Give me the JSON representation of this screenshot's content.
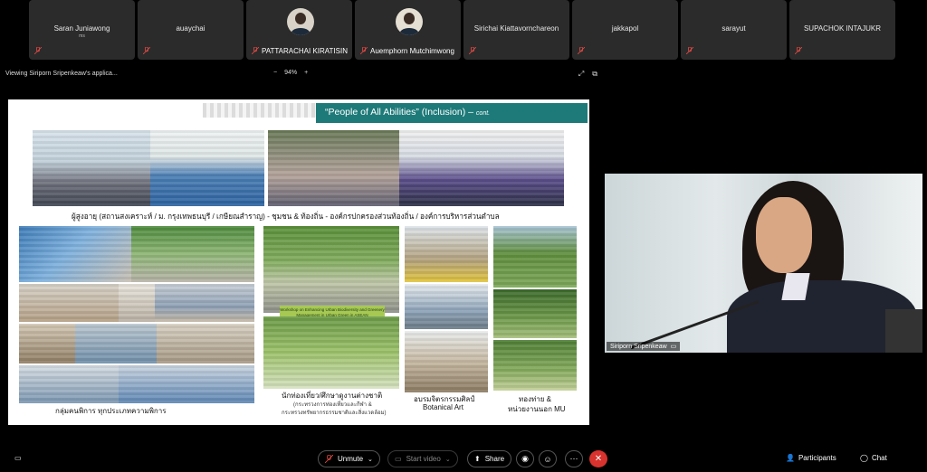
{
  "participants": [
    {
      "name": "Saran Juniawong",
      "sub": "ms"
    },
    {
      "name": "auaychai",
      "sub": ""
    },
    {
      "name": "PATTARACHAI KIRATISIN",
      "sub": "",
      "avatar": true
    },
    {
      "name": "Auemphorn Mutchimwong",
      "sub": "",
      "avatar": true
    },
    {
      "name": "Sirichai Kiattavornchareon",
      "sub": ""
    },
    {
      "name": "jakkapol",
      "sub": ""
    },
    {
      "name": "sarayut",
      "sub": ""
    },
    {
      "name": "SUPACHOK INTAJUKR",
      "sub": ""
    }
  ],
  "share": {
    "title": "Viewing Siriporn Sripenkeaw's applica...",
    "zoom_minus": "−",
    "zoom": "94%",
    "zoom_plus": "+"
  },
  "slide": {
    "banner": "“People of All Abilities” (Inclusion) –",
    "banner_cont": "cont.",
    "captions": {
      "row1": "ผู้สูงอายุ (สถานสงเคราะห์ / ม. กรุงเทพธนบุรี / เกษียณสำราญ) - ชุมชน & ท้องถิ่น - องค์กรปกครองส่วนท้องถิ่น / องค์การบริหารส่วนตำบล",
      "disabled": "กลุ่มคนพิการ ทุกประเภทความพิการ",
      "tourist": "นักท่องเที่ยว/ศึกษาดูงานต่างชาติ",
      "tourist_sub1": "(กระทรวงการท่องเที่ยวและกีฬา &",
      "tourist_sub2": "กระทรวงทรัพยากรธรรมชาติและสิ่งแวดล้อม)",
      "training1": "อบรมจิตรกรรมศิลป์",
      "training2": "Botanical Art",
      "camp1": "ทองท่าย &",
      "camp2": "หน่วยงานนอก MU"
    },
    "workshop_label": "Workshop on Enhancing Urban Biodiversity and Greenery Management in Urban Green in ASEAN"
  },
  "speaker": {
    "name": "Siriporn Sripenkeaw"
  },
  "toolbar": {
    "unmute": "Unmute",
    "start_video": "Start video",
    "share": "Share",
    "participants": "Participants",
    "chat": "Chat"
  },
  "icons": {
    "mic_muted": "mic-muted-icon",
    "chevron": "chevron-down-icon",
    "video": "video-off-icon",
    "share": "share-icon",
    "ai": "ai-assistant-icon",
    "reactions": "reactions-icon",
    "more": "more-icon",
    "end": "end-call-icon",
    "captions": "captions-icon",
    "participants": "participants-icon",
    "chat": "chat-icon"
  },
  "colors": {
    "muted": "#d8332e",
    "end_call": "#d8332e",
    "banner": "#1e7a79",
    "workshop": "#a7c954"
  }
}
